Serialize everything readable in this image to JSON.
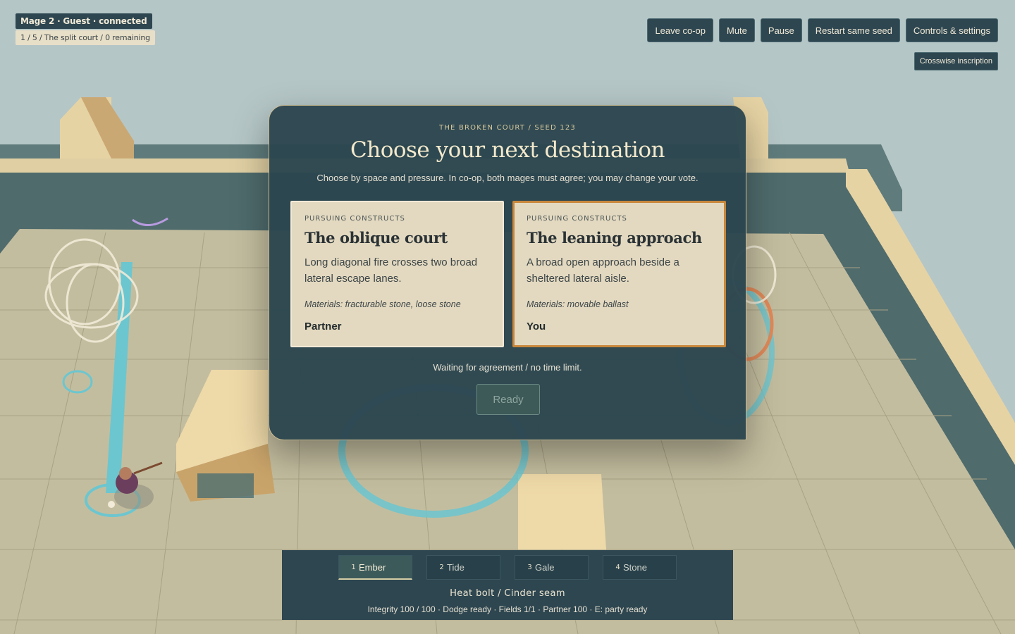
{
  "hud": {
    "status": "Mage 2 · Guest · connected",
    "progress": "1 / 5 / The split court / 0 remaining"
  },
  "topbar": {
    "buttons": [
      "Leave co-op",
      "Mute",
      "Pause",
      "Restart same seed",
      "Controls & settings"
    ],
    "inscription": "Crosswise inscription"
  },
  "modal": {
    "eyebrow": "THE BROKEN COURT / SEED 123",
    "title": "Choose your next destination",
    "subtitle": "Choose by space and pressure. In co-op, both mages must agree; you may change your vote.",
    "cards": [
      {
        "kicker": "PURSUING CONSTRUCTS",
        "title": "The oblique court",
        "description": "Long diagonal fire crosses two broad lateral escape lanes.",
        "materials": "Materials: fracturable stone, loose stone",
        "voter": "Partner",
        "selected": false
      },
      {
        "kicker": "PURSUING CONSTRUCTS",
        "title": "The leaning approach",
        "description": "A broad open approach beside a sheltered lateral aisle.",
        "materials": "Materials: movable ballast",
        "voter": "You",
        "selected": true
      }
    ],
    "waiting": "Waiting for agreement / no time limit.",
    "ready_label": "Ready"
  },
  "spellbar": {
    "slots": [
      {
        "key": "1",
        "name": "Ember",
        "active": true
      },
      {
        "key": "2",
        "name": "Tide",
        "active": false
      },
      {
        "key": "3",
        "name": "Gale",
        "active": false
      },
      {
        "key": "4",
        "name": "Stone",
        "active": false
      }
    ],
    "spell": "Heat bolt / Cinder seam",
    "stats": "Integrity 100 / 100 · Dodge ready · Fields 1/1 · Partner 100 · E: party ready"
  },
  "colors": {
    "panel": "#2e4650",
    "parchment": "#e3d9c0",
    "selected_border": "#c8873b",
    "floor": "#c3bd9f",
    "water_trail": "#6cc6cf"
  }
}
